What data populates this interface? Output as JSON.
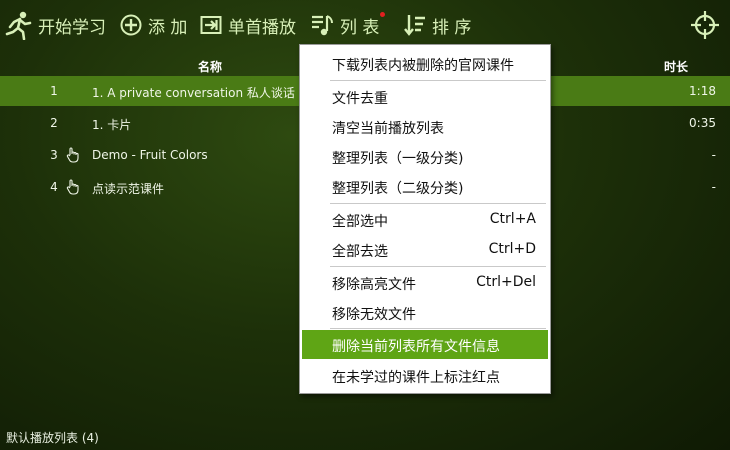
{
  "toolbar": {
    "study": "开始学习",
    "add": "添 加",
    "single": "单首播放",
    "list": "列 表",
    "sort": "排 序"
  },
  "table": {
    "col_name": "名称",
    "col_duration": "时长",
    "rows": [
      {
        "num": "1",
        "title": "1. A private conversation 私人谈话",
        "duration": "1:18"
      },
      {
        "num": "2",
        "title": "1. 卡片",
        "duration": "0:35"
      },
      {
        "num": "3",
        "title": "Demo - Fruit Colors",
        "duration": "-"
      },
      {
        "num": "4",
        "title": "点读示范课件",
        "duration": "-"
      }
    ]
  },
  "menu": {
    "items": [
      {
        "label": "下载列表内被删除的官网课件",
        "shortcut": ""
      },
      {
        "label": "文件去重",
        "shortcut": ""
      },
      {
        "label": "清空当前播放列表",
        "shortcut": ""
      },
      {
        "label": "整理列表（一级分类)",
        "shortcut": ""
      },
      {
        "label": "整理列表（二级分类)",
        "shortcut": ""
      },
      {
        "label": "全部选中",
        "shortcut": "Ctrl+A"
      },
      {
        "label": "全部去选",
        "shortcut": "Ctrl+D"
      },
      {
        "label": "移除高亮文件",
        "shortcut": "Ctrl+Del"
      },
      {
        "label": "移除无效文件",
        "shortcut": ""
      },
      {
        "label": "删除当前列表所有文件信息",
        "shortcut": ""
      },
      {
        "label": "在未学过的课件上标注红点",
        "shortcut": ""
      }
    ]
  },
  "status": "默认播放列表 (4)",
  "colors": {
    "accent": "#5fa515",
    "selected_row": "#4a7b15",
    "toolbar_text": "#d8f0b8"
  }
}
